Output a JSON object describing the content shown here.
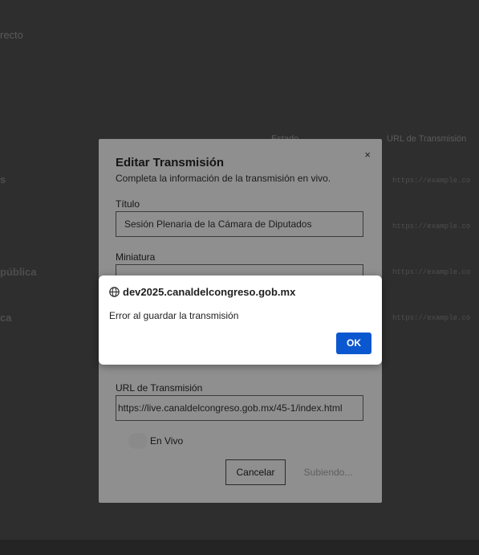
{
  "background": {
    "top_text": "recto",
    "column_estado": "Estado",
    "column_url": "URL de Transmisión",
    "row_labels": [
      "s",
      "pública",
      "ca"
    ],
    "row_urls": [
      "https://example.co",
      "https://example.co",
      "https://example.co",
      "https://example.co"
    ]
  },
  "modal": {
    "title": "Editar Transmisión",
    "subtitle": "Completa la información de la transmisión en vivo.",
    "close": "×",
    "titulo_label": "Título",
    "titulo_value": "Sesión Plenaria de la Cámara de Diputados",
    "miniatura_label": "Miniatura",
    "url_label": "URL de Transmisión",
    "url_value": "https://live.canaldelcongreso.gob.mx/45-1/index.html",
    "en_vivo_label": "En Vivo",
    "cancel_label": "Cancelar",
    "upload_label": "Subiendo..."
  },
  "alert": {
    "origin": "dev2025.canaldelcongreso.gob.mx",
    "message": "Error al guardar la transmisión",
    "ok_label": "OK",
    "ok_color": "#0b57d0"
  }
}
